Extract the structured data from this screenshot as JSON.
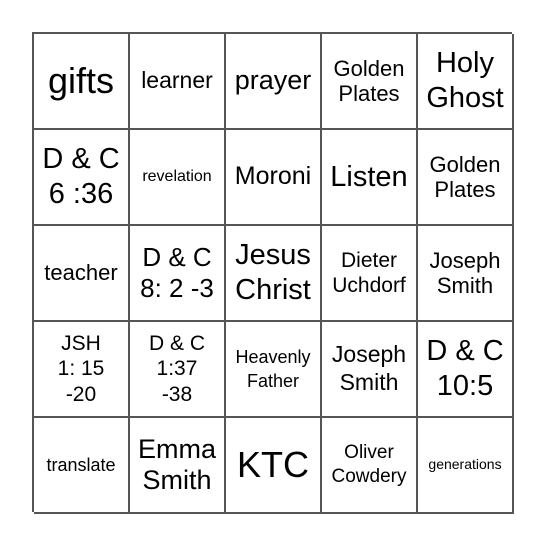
{
  "board": {
    "cells": [
      "gifts",
      "learner",
      "prayer",
      "Golden\nPlates",
      "Holy\nGhost",
      "D & C\n6 :36",
      "revelation",
      "Moroni",
      "Listen",
      "Golden\nPlates",
      "teacher",
      "D & C\n8: 2 -3",
      "Jesus\nChrist",
      "Dieter\nUchdorf",
      "Joseph\nSmith",
      "JSH\n1: 15\n-20",
      "D & C\n1:37\n-38",
      "Heavenly\nFather",
      "Joseph\nSmith",
      "D & C\n10:5",
      "translate",
      "Emma\nSmith",
      "KTC",
      "Oliver\nCowdery",
      "generations"
    ]
  }
}
